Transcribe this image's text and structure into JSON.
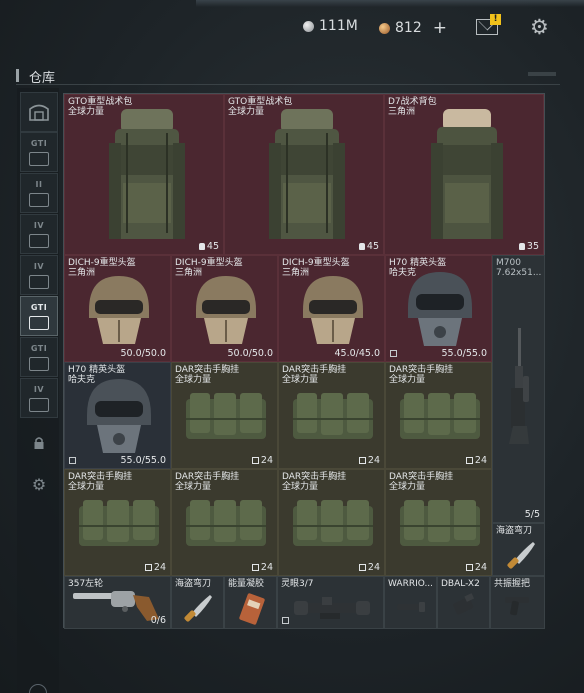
{
  "currency": {
    "silver": "111M",
    "gold": "812",
    "add": "+"
  },
  "mail_badge": "!",
  "section_title": "仓库",
  "tabs": [
    {
      "label": "",
      "icon": "storage-icon"
    },
    {
      "label": "GTI",
      "icon": "container-icon"
    },
    {
      "label": "II",
      "icon": "container-icon"
    },
    {
      "label": "IV",
      "icon": "container-icon"
    },
    {
      "label": "IV",
      "icon": "container-icon"
    },
    {
      "label": "GTI",
      "icon": "container-icon"
    },
    {
      "label": "GTI",
      "icon": "container-icon"
    },
    {
      "label": "IV",
      "icon": "container-icon"
    },
    {
      "label": "",
      "icon": "lock-icon"
    },
    {
      "label": "",
      "icon": "gear-icon"
    }
  ],
  "items": {
    "bag1": {
      "name": "GTO重型战术包",
      "sub": "全球力量",
      "value": "45"
    },
    "bag2": {
      "name": "GTO重型战术包",
      "sub": "全球力量",
      "value": "45"
    },
    "bag3": {
      "name": "D7战术背包",
      "sub": "三角洲",
      "value": "35"
    },
    "helmet1": {
      "name": "DICH-9重型头盔",
      "sub": "三角洲",
      "value": "50.0/50.0"
    },
    "helmet2": {
      "name": "DICH-9重型头盔",
      "sub": "三角洲",
      "value": "50.0/50.0"
    },
    "helmet3": {
      "name": "DICH-9重型头盔",
      "sub": "三角洲",
      "value": "45.0/45.0"
    },
    "helmet4": {
      "name": "H70 精英头盔",
      "sub": "哈夫克",
      "value": "55.0/55.0"
    },
    "rifle": {
      "name": "M700",
      "sub": "7.62x51...",
      "value": "5/5"
    },
    "helmet5": {
      "name": "H70 精英头盔",
      "sub": "哈夫克",
      "value": "55.0/55.0"
    },
    "rig1": {
      "name": "DAR突击手胸挂",
      "sub": "全球力量",
      "value": "24"
    },
    "rig2": {
      "name": "DAR突击手胸挂",
      "sub": "全球力量",
      "value": "24"
    },
    "rig3": {
      "name": "DAR突击手胸挂",
      "sub": "全球力量",
      "value": "24"
    },
    "rig4": {
      "name": "DAR突击手胸挂",
      "sub": "全球力量",
      "value": "24"
    },
    "rig5": {
      "name": "DAR突击手胸挂",
      "sub": "全球力量",
      "value": "24"
    },
    "rig6": {
      "name": "DAR突击手胸挂",
      "sub": "全球力量",
      "value": "24"
    },
    "rig7": {
      "name": "DAR突击手胸挂",
      "sub": "全球力量",
      "value": "24"
    },
    "knife1": {
      "name": "海盗弯刀",
      "sub": "",
      "value": ""
    },
    "revolver": {
      "name": "357左轮",
      "sub": "",
      "value": "0/6"
    },
    "knife2": {
      "name": "海盗弯刀",
      "sub": "",
      "value": ""
    },
    "gel": {
      "name": "能量凝胶",
      "sub": "",
      "value": ""
    },
    "scope": {
      "name": "灵眼3/7",
      "sub": "",
      "value": ""
    },
    "warrior": {
      "name": "WARRIO...",
      "sub": "",
      "value": ""
    },
    "dbal": {
      "name": "DBAL-X2",
      "sub": "",
      "value": ""
    },
    "grip": {
      "name": "共振握把",
      "sub": "",
      "value": ""
    }
  },
  "colors": {
    "red_cell": "#4b2730",
    "olive_cell": "#3b3a2e",
    "grey_cell": "#2c3236",
    "accent_badge": "#f2c21b"
  }
}
